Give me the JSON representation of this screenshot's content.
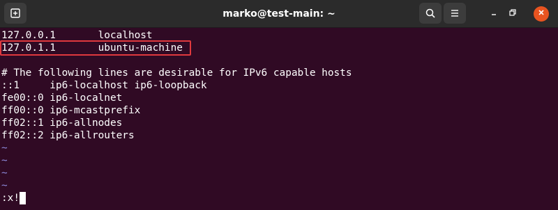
{
  "window": {
    "title": "marko@test-main: ~",
    "accent_close": "#e95420",
    "icons": {
      "new_tab": "new-tab-icon",
      "search": "search-icon",
      "menu": "hamburger-menu-icon",
      "minimize": "minimize-icon",
      "maximize": "maximize-icon",
      "close": "close-icon"
    }
  },
  "terminal": {
    "background": "#300a24",
    "lines": [
      "127.0.0.1       localhost",
      "127.0.1.1       ubuntu-machine",
      "",
      "# The following lines are desirable for IPv6 capable hosts",
      "::1     ip6-localhost ip6-loopback",
      "fe00::0 ip6-localnet",
      "ff00::0 ip6-mcastprefix",
      "ff02::1 ip6-allnodes",
      "ff02::2 ip6-allrouters",
      "~",
      "~",
      "~",
      "~"
    ],
    "command": ":x!",
    "highlight_color": "#e0393e"
  }
}
